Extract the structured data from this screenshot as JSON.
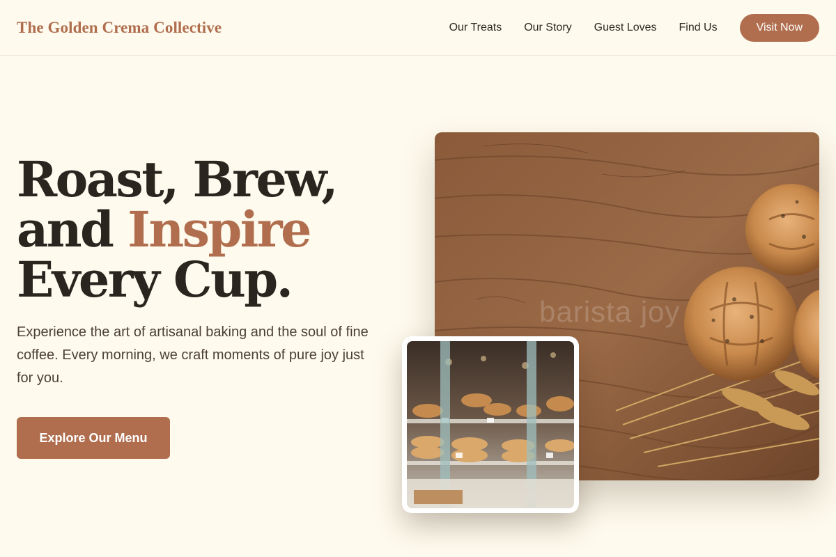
{
  "brand": {
    "name": "The Golden Crema Collective"
  },
  "nav": {
    "links": [
      "Our Treats",
      "Our Story",
      "Guest Loves",
      "Find Us"
    ],
    "cta": "Visit Now"
  },
  "hero": {
    "title_line1": "Roast, Brew,",
    "title_line2_prefix": "and ",
    "title_line2_accent": "Inspire",
    "title_line3": "Every Cup.",
    "description": "Experience the art of artisanal baking and the soul of fine coffee. Every morning, we craft moments of pure joy just for you.",
    "cta": "Explore Our Menu"
  },
  "images": {
    "main_watermark": "barista joy"
  },
  "colors": {
    "accent": "#b06e4e",
    "background": "#fefaed",
    "heading": "#2a251f"
  }
}
